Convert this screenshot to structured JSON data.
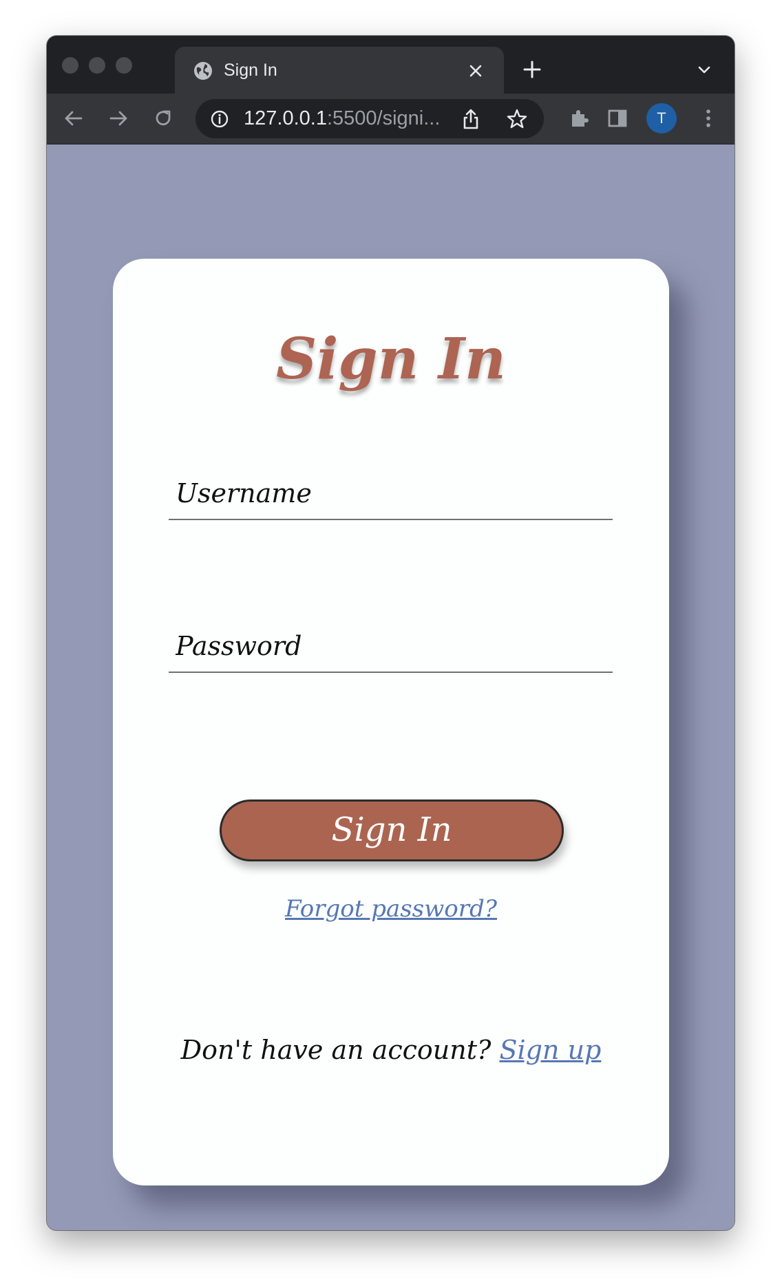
{
  "browser": {
    "tab": {
      "title": "Sign In",
      "icon": "globe-icon"
    },
    "address_bar": {
      "host": "127.0.0.1",
      "rest": ":5500/signi..."
    },
    "profile": {
      "initial": "T",
      "color": "#1f5fa6"
    }
  },
  "page": {
    "background_color": "#9499b6",
    "accent_color": "#ab6450",
    "link_color": "#5677b4",
    "title": "Sign In",
    "form": {
      "username": {
        "placeholder": "Username",
        "value": ""
      },
      "password": {
        "placeholder": "Password",
        "value": ""
      },
      "submit_label": "Sign In"
    },
    "forgot_password": "Forgot password?",
    "signup_prompt": "Don't have an account?",
    "signup_link": "Sign up"
  }
}
